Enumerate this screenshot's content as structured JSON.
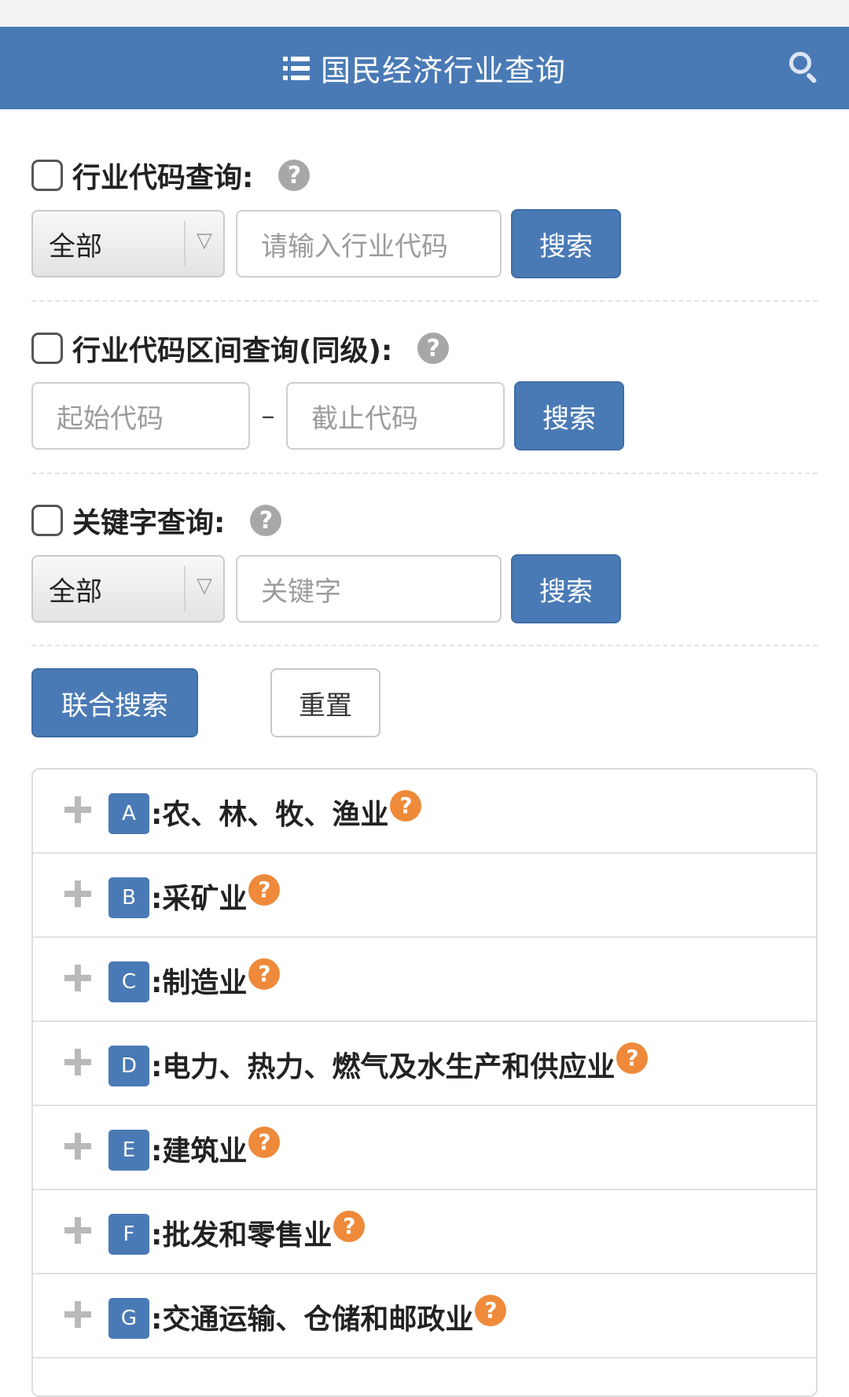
{
  "header": {
    "title": "国民经济行业查询",
    "menu_icon": "list-icon",
    "search_icon": "search-icon"
  },
  "section_code": {
    "label": "行业代码查询:",
    "select_value": "全部",
    "input_placeholder": "请输入行业代码",
    "search_label": "搜索"
  },
  "section_range": {
    "label": "行业代码区间查询(同级):",
    "start_placeholder": "起始代码",
    "separator": "–",
    "end_placeholder": "截止代码",
    "search_label": "搜索"
  },
  "section_keyword": {
    "label": "关键字查询:",
    "select_value": "全部",
    "input_placeholder": "关键字",
    "search_label": "搜索"
  },
  "actions": {
    "combined_search": "联合搜索",
    "reset": "重置"
  },
  "help_glyph": "?",
  "tree": {
    "items": [
      {
        "code": "A",
        "name": ":农、林、牧、渔业"
      },
      {
        "code": "B",
        "name": ":采矿业"
      },
      {
        "code": "C",
        "name": ":制造业"
      },
      {
        "code": "D",
        "name": ":电力、热力、燃气及水生产和供应业"
      },
      {
        "code": "E",
        "name": ":建筑业"
      },
      {
        "code": "F",
        "name": ":批发和零售业"
      },
      {
        "code": "G",
        "name": ":交通运输、仓储和邮政业"
      }
    ]
  },
  "colors": {
    "primary": "#4a7ab5",
    "help_orange": "#ee8a3a",
    "help_grey": "#a7a7a7"
  }
}
